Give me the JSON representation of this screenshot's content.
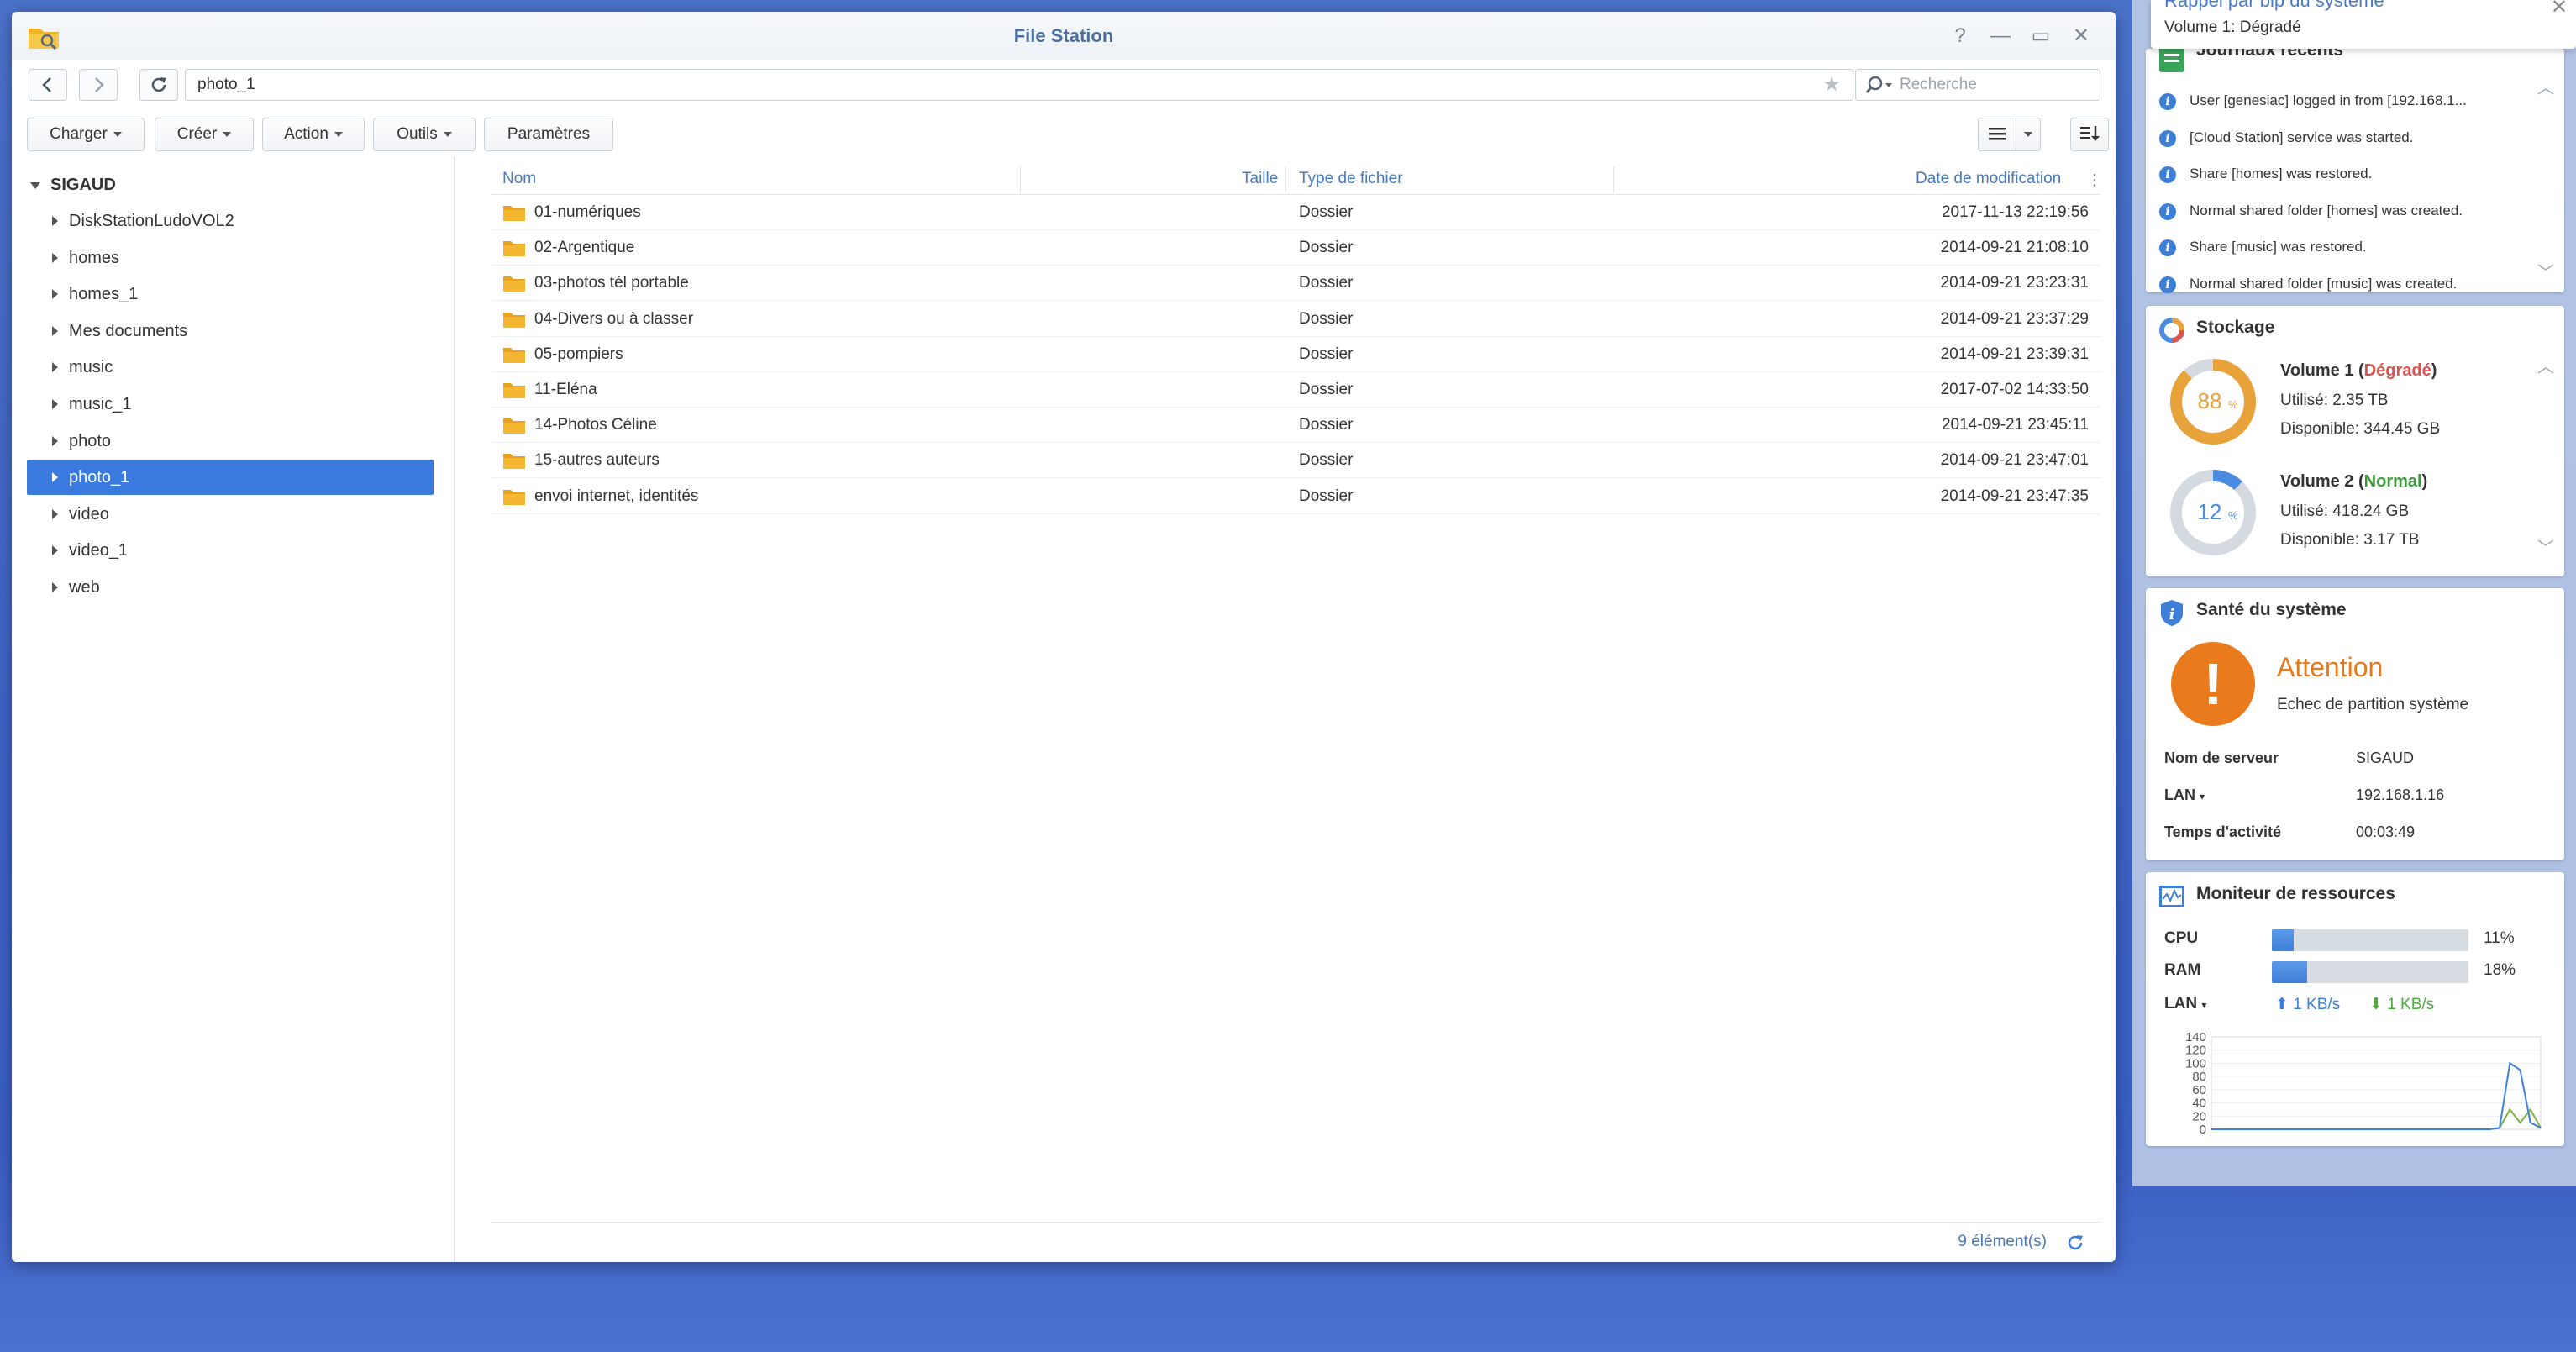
{
  "window": {
    "title": "File Station",
    "help_glyph": "?",
    "min_glyph": "—",
    "max_glyph": "▭",
    "close_glyph": "✕"
  },
  "nav": {
    "path": "photo_1",
    "search_placeholder": "Recherche"
  },
  "toolbar": {
    "charger": "Charger",
    "creer": "Créer",
    "action": "Action",
    "outils": "Outils",
    "parametres": "Paramètres"
  },
  "tree": {
    "root": "SIGAUD",
    "items": [
      {
        "label": "DiskStationLudoVOL2",
        "selected": false
      },
      {
        "label": "homes",
        "selected": false
      },
      {
        "label": "homes_1",
        "selected": false
      },
      {
        "label": "Mes documents",
        "selected": false
      },
      {
        "label": "music",
        "selected": false
      },
      {
        "label": "music_1",
        "selected": false
      },
      {
        "label": "photo",
        "selected": false
      },
      {
        "label": "photo_1",
        "selected": true
      },
      {
        "label": "video",
        "selected": false
      },
      {
        "label": "video_1",
        "selected": false
      },
      {
        "label": "web",
        "selected": false
      }
    ]
  },
  "columns": {
    "name": "Nom",
    "size": "Taille",
    "type": "Type de fichier",
    "date": "Date de modification"
  },
  "files": [
    {
      "name": "01-numériques",
      "type": "Dossier",
      "date": "2017-11-13 22:19:56"
    },
    {
      "name": "02-Argentique",
      "type": "Dossier",
      "date": "2014-09-21 21:08:10"
    },
    {
      "name": "03-photos tél portable",
      "type": "Dossier",
      "date": "2014-09-21 23:23:31"
    },
    {
      "name": "04-Divers ou à classer",
      "type": "Dossier",
      "date": "2014-09-21 23:37:29"
    },
    {
      "name": "05-pompiers",
      "type": "Dossier",
      "date": "2014-09-21 23:39:31"
    },
    {
      "name": "11-Eléna",
      "type": "Dossier",
      "date": "2017-07-02 14:33:50"
    },
    {
      "name": "14-Photos Céline",
      "type": "Dossier",
      "date": "2014-09-21 23:45:11"
    },
    {
      "name": "15-autres auteurs",
      "type": "Dossier",
      "date": "2014-09-21 23:47:01"
    },
    {
      "name": "envoi internet, identités",
      "type": "Dossier",
      "date": "2014-09-21 23:47:35"
    }
  ],
  "footer": {
    "count": "9 élément(s)"
  },
  "notification": {
    "title": "Rappel par bip du système",
    "text": "Volume 1: Dégradé"
  },
  "logs": {
    "title": "Journaux récents",
    "items": [
      "User [genesiac] logged in from [192.168.1...",
      "[Cloud Station] service was started.",
      "Share [homes] was restored.",
      "Normal shared folder [homes] was created.",
      "Share [music] was restored.",
      "Normal shared folder [music] was created."
    ]
  },
  "storage": {
    "title": "Stockage",
    "volumes": [
      {
        "name": "Volume 1",
        "status": "Dégradé",
        "percent": 88,
        "pct_label": "88",
        "used": "Utilisé: 2.35 TB",
        "free": "Disponible: 344.45 GB",
        "color": "#e8a23a"
      },
      {
        "name": "Volume 2",
        "status": "Normal",
        "percent": 12,
        "pct_label": "12",
        "used": "Utilisé: 418.24 GB",
        "free": "Disponible: 3.17 TB",
        "color": "#4a8de0"
      }
    ]
  },
  "health": {
    "title": "Santé du système",
    "status": "Attention",
    "message": "Echec de partition système",
    "server_label": "Nom de serveur",
    "server_value": "SIGAUD",
    "lan_label": "LAN",
    "lan_value": "192.168.1.16",
    "uptime_label": "Temps d'activité",
    "uptime_value": "00:03:49"
  },
  "resources": {
    "title": "Moniteur de ressources",
    "cpu_label": "CPU",
    "cpu_percent": 11,
    "cpu_text": "11%",
    "ram_label": "RAM",
    "ram_percent": 18,
    "ram_text": "18%",
    "lan_label": "LAN",
    "up": "1 KB/s",
    "down": "1 KB/s",
    "chart_ticks": [
      "140",
      "120",
      "100",
      "80",
      "60",
      "40",
      "20",
      "0"
    ],
    "up_series": [
      0,
      0,
      0,
      0,
      0,
      0,
      0,
      0,
      0,
      0,
      0,
      0,
      0,
      0,
      0,
      0,
      0,
      0,
      0,
      0,
      0,
      0,
      0,
      0,
      0,
      0,
      0,
      0,
      2,
      100,
      90,
      10,
      2
    ],
    "down_series": [
      0,
      0,
      0,
      0,
      0,
      0,
      0,
      0,
      0,
      0,
      0,
      0,
      0,
      0,
      0,
      0,
      0,
      0,
      0,
      0,
      0,
      0,
      0,
      0,
      0,
      0,
      0,
      0,
      2,
      30,
      10,
      30,
      2
    ]
  },
  "colors": {
    "accent": "#3b7be0",
    "link": "#4a79b7",
    "warning": "#e97b1d",
    "degraded": "#d9534f",
    "normal": "#3a9a3a"
  }
}
